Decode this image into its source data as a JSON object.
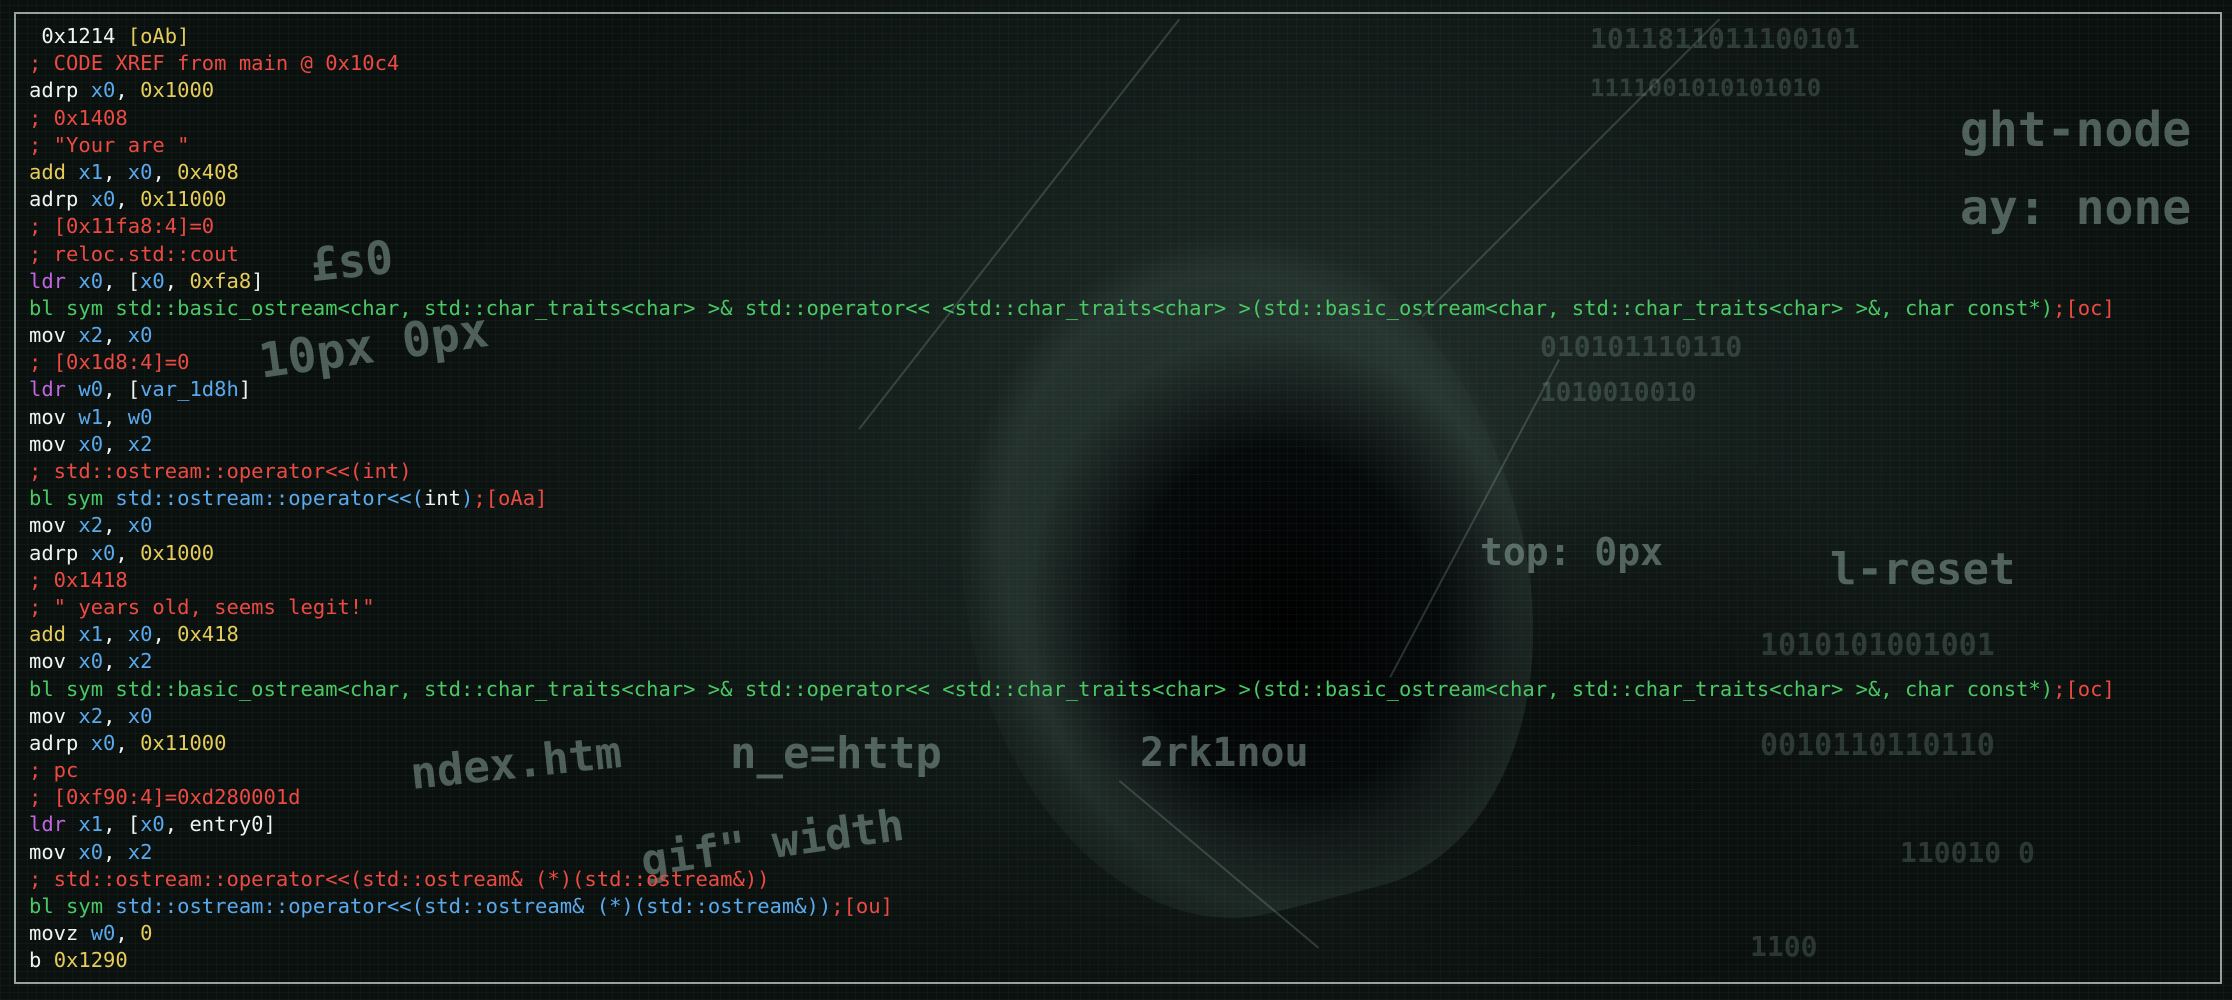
{
  "background": {
    "words": [
      {
        "text": "ght-node"
      },
      {
        "text": "ay: none"
      },
      {
        "text": "1011811011100101"
      },
      {
        "text": "1111001010101010"
      },
      {
        "text": "10px 0px"
      },
      {
        "text": "010101110110"
      },
      {
        "text": "1010010010"
      },
      {
        "text": "top: 0px"
      },
      {
        "text": "l-reset"
      },
      {
        "text": "1010101001001"
      },
      {
        "text": "0010110110110"
      },
      {
        "text": "ndex.htm"
      },
      {
        "text": "n_e=http"
      },
      {
        "text": "2rk1nou"
      },
      {
        "text": "gif\" width"
      },
      {
        "text": "1100"
      },
      {
        "text": "110010 0"
      },
      {
        "text": "£s0"
      }
    ]
  },
  "disasm": {
    "lines": [
      [
        {
          "t": " 0x1214 ",
          "c": "white"
        },
        {
          "t": "[oAb]",
          "c": "yellow"
        }
      ],
      [
        {
          "t": "; CODE XREF from main @ 0x10c4",
          "c": "red"
        }
      ],
      [
        {
          "t": "adrp ",
          "c": "white"
        },
        {
          "t": "x0",
          "c": "blue"
        },
        {
          "t": ", ",
          "c": "white"
        },
        {
          "t": "0x1000",
          "c": "yellow"
        }
      ],
      [
        {
          "t": "; 0x1408",
          "c": "red"
        }
      ],
      [
        {
          "t": "; \"Your are \"",
          "c": "red"
        }
      ],
      [
        {
          "t": "add ",
          "c": "yellow"
        },
        {
          "t": "x1",
          "c": "blue"
        },
        {
          "t": ", ",
          "c": "white"
        },
        {
          "t": "x0",
          "c": "blue"
        },
        {
          "t": ", ",
          "c": "white"
        },
        {
          "t": "0x408",
          "c": "yellow"
        }
      ],
      [
        {
          "t": "adrp ",
          "c": "white"
        },
        {
          "t": "x0",
          "c": "blue"
        },
        {
          "t": ", ",
          "c": "white"
        },
        {
          "t": "0x11000",
          "c": "yellow"
        }
      ],
      [
        {
          "t": "; [0x11fa8:4]=0",
          "c": "red"
        }
      ],
      [
        {
          "t": "; reloc.std::cout",
          "c": "red"
        }
      ],
      [
        {
          "t": "ldr ",
          "c": "purple"
        },
        {
          "t": "x0",
          "c": "blue"
        },
        {
          "t": ", [",
          "c": "white"
        },
        {
          "t": "x0",
          "c": "blue"
        },
        {
          "t": ", ",
          "c": "white"
        },
        {
          "t": "0xfa8",
          "c": "yellow"
        },
        {
          "t": "]",
          "c": "white"
        }
      ],
      [
        {
          "t": "bl sym std::basic_ostream<char, std::char_traits<char> >& std::operator<< <std::char_traits<char> >(std::basic_ostream<char, std::char_traits<char> >&, char const*)",
          "c": "green"
        },
        {
          "t": ";[oc]",
          "c": "red"
        }
      ],
      [
        {
          "t": "mov ",
          "c": "white"
        },
        {
          "t": "x2",
          "c": "blue"
        },
        {
          "t": ", ",
          "c": "white"
        },
        {
          "t": "x0",
          "c": "blue"
        }
      ],
      [
        {
          "t": "; [0x1d8:4]=0",
          "c": "red"
        }
      ],
      [
        {
          "t": "ldr ",
          "c": "purple"
        },
        {
          "t": "w0",
          "c": "blue"
        },
        {
          "t": ", [",
          "c": "white"
        },
        {
          "t": "var_1d8h",
          "c": "blue"
        },
        {
          "t": "]",
          "c": "white"
        }
      ],
      [
        {
          "t": "mov ",
          "c": "white"
        },
        {
          "t": "w1",
          "c": "blue"
        },
        {
          "t": ", ",
          "c": "white"
        },
        {
          "t": "w0",
          "c": "blue"
        }
      ],
      [
        {
          "t": "mov ",
          "c": "white"
        },
        {
          "t": "x0",
          "c": "blue"
        },
        {
          "t": ", ",
          "c": "white"
        },
        {
          "t": "x2",
          "c": "blue"
        }
      ],
      [
        {
          "t": "; std::ostream::operator<<(int)",
          "c": "red"
        }
      ],
      [
        {
          "t": "bl sym ",
          "c": "green"
        },
        {
          "t": "std::ostream::operator<<(",
          "c": "blue"
        },
        {
          "t": "int",
          "c": "white"
        },
        {
          "t": ")",
          "c": "blue"
        },
        {
          "t": ";[oAa]",
          "c": "red"
        }
      ],
      [
        {
          "t": "mov ",
          "c": "white"
        },
        {
          "t": "x2",
          "c": "blue"
        },
        {
          "t": ", ",
          "c": "white"
        },
        {
          "t": "x0",
          "c": "blue"
        }
      ],
      [
        {
          "t": "adrp ",
          "c": "white"
        },
        {
          "t": "x0",
          "c": "blue"
        },
        {
          "t": ", ",
          "c": "white"
        },
        {
          "t": "0x1000",
          "c": "yellow"
        }
      ],
      [
        {
          "t": "; 0x1418",
          "c": "red"
        }
      ],
      [
        {
          "t": "; \" years old, seems legit!\"",
          "c": "red"
        }
      ],
      [
        {
          "t": "add ",
          "c": "yellow"
        },
        {
          "t": "x1",
          "c": "blue"
        },
        {
          "t": ", ",
          "c": "white"
        },
        {
          "t": "x0",
          "c": "blue"
        },
        {
          "t": ", ",
          "c": "white"
        },
        {
          "t": "0x418",
          "c": "yellow"
        }
      ],
      [
        {
          "t": "mov ",
          "c": "white"
        },
        {
          "t": "x0",
          "c": "blue"
        },
        {
          "t": ", ",
          "c": "white"
        },
        {
          "t": "x2",
          "c": "blue"
        }
      ],
      [
        {
          "t": "bl sym std::basic_ostream<char, std::char_traits<char> >& std::operator<< <std::char_traits<char> >(std::basic_ostream<char, std::char_traits<char> >&, char const*)",
          "c": "green"
        },
        {
          "t": ";[oc]",
          "c": "red"
        }
      ],
      [
        {
          "t": "mov ",
          "c": "white"
        },
        {
          "t": "x2",
          "c": "blue"
        },
        {
          "t": ", ",
          "c": "white"
        },
        {
          "t": "x0",
          "c": "blue"
        }
      ],
      [
        {
          "t": "adrp ",
          "c": "white"
        },
        {
          "t": "x0",
          "c": "blue"
        },
        {
          "t": ", ",
          "c": "white"
        },
        {
          "t": "0x11000",
          "c": "yellow"
        }
      ],
      [
        {
          "t": "; pc",
          "c": "red"
        }
      ],
      [
        {
          "t": "; [0xf90:4]=0xd280001d",
          "c": "red"
        }
      ],
      [
        {
          "t": "ldr ",
          "c": "purple"
        },
        {
          "t": "x1",
          "c": "blue"
        },
        {
          "t": ", [",
          "c": "white"
        },
        {
          "t": "x0",
          "c": "blue"
        },
        {
          "t": ", entry0]",
          "c": "white"
        }
      ],
      [
        {
          "t": "mov ",
          "c": "white"
        },
        {
          "t": "x0",
          "c": "blue"
        },
        {
          "t": ", ",
          "c": "white"
        },
        {
          "t": "x2",
          "c": "blue"
        }
      ],
      [
        {
          "t": "; std::ostream::operator<<(std::ostream& (*)(std::ostream&))",
          "c": "red"
        }
      ],
      [
        {
          "t": "bl sym ",
          "c": "green"
        },
        {
          "t": "std::ostream::operator<<(std::ostream& (*)(std::ostream&))",
          "c": "blue"
        },
        {
          "t": ";[ou]",
          "c": "red"
        }
      ],
      [
        {
          "t": "movz ",
          "c": "white"
        },
        {
          "t": "w0",
          "c": "blue"
        },
        {
          "t": ", ",
          "c": "white"
        },
        {
          "t": "0",
          "c": "yellow"
        }
      ],
      [
        {
          "t": "b ",
          "c": "white"
        },
        {
          "t": "0x1290",
          "c": "yellow"
        }
      ]
    ]
  }
}
